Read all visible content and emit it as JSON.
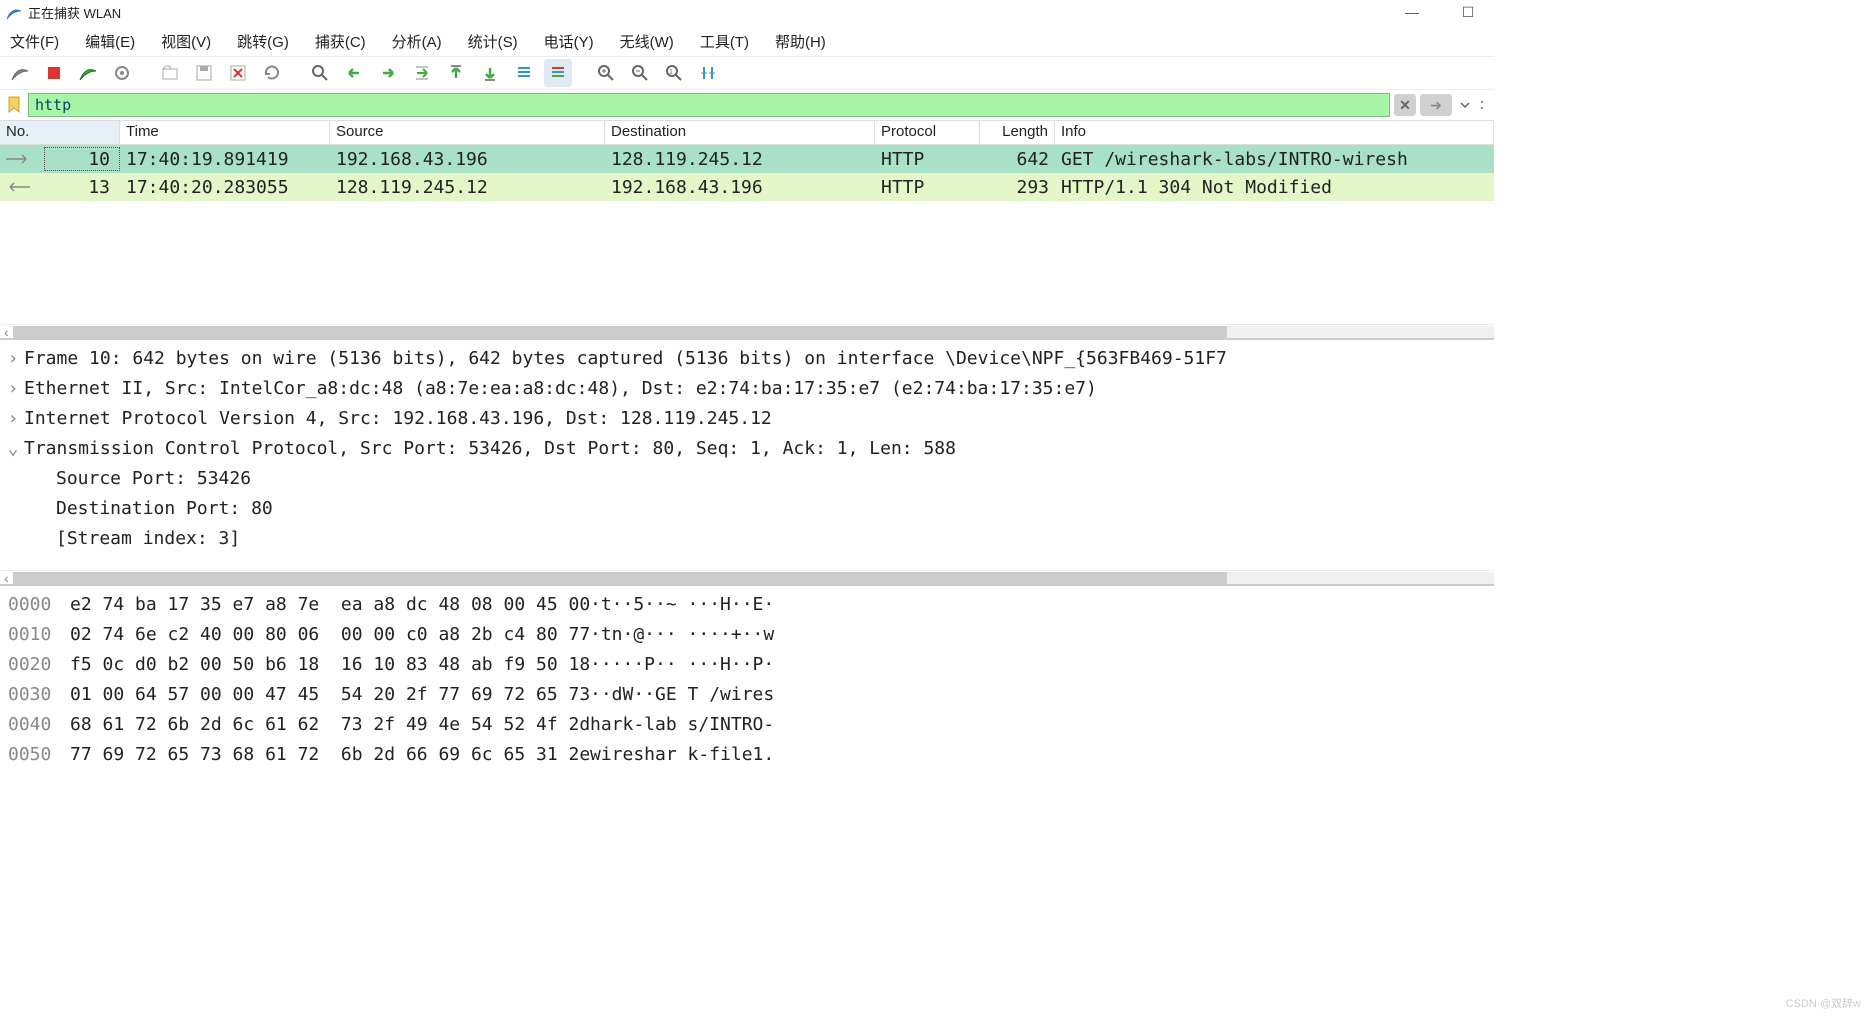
{
  "window": {
    "title": "正在捕获 WLAN",
    "minimize": "—",
    "maximize": "☐",
    "close": "✕"
  },
  "menu": {
    "file": "文件(F)",
    "edit": "编辑(E)",
    "view": "视图(V)",
    "go": "跳转(G)",
    "capture": "捕获(C)",
    "analyze": "分析(A)",
    "statistics": "统计(S)",
    "telephony": "电话(Y)",
    "wireless": "无线(W)",
    "tools": "工具(T)",
    "help": "帮助(H)"
  },
  "toolbar_icons": {
    "start": "start-icon",
    "stop": "stop-icon",
    "restart": "restart-icon",
    "options": "options-icon",
    "open": "open-icon",
    "save": "save-icon",
    "close": "close-file-icon",
    "reload": "reload-icon",
    "find": "find-icon",
    "back": "back-icon",
    "forward": "forward-icon",
    "jump": "jump-icon",
    "first": "first-icon",
    "last": "last-icon",
    "auto_scroll": "auto-scroll-icon",
    "colorize": "colorize-icon",
    "zoom_in": "zoom-in-icon",
    "zoom_out": "zoom-out-icon",
    "zoom_reset": "zoom-reset-icon",
    "resize_cols": "resize-cols-icon"
  },
  "filter": {
    "value": "http",
    "clear": "✕",
    "apply": "➔"
  },
  "columns": {
    "no": "No.",
    "time": "Time",
    "source": "Source",
    "destination": "Destination",
    "protocol": "Protocol",
    "length": "Length",
    "info": "Info"
  },
  "packets": [
    {
      "no": "10",
      "time": "17:40:19.891419",
      "source": "192.168.43.196",
      "destination": "128.119.245.12",
      "protocol": "HTTP",
      "length": "642",
      "info": "GET  /wireshark-labs/INTRO-wiresh",
      "selected": true,
      "direction": "out"
    },
    {
      "no": "13",
      "time": "17:40:20.283055",
      "source": "128.119.245.12",
      "destination": "192.168.43.196",
      "protocol": "HTTP",
      "length": "293",
      "info": "HTTP/1.1 304 Not Modified",
      "selected": false,
      "direction": "in"
    }
  ],
  "details": {
    "frame": "Frame 10: 642 bytes on wire (5136 bits), 642 bytes captured (5136 bits) on interface \\Device\\NPF_{563FB469-51F7",
    "eth": "Ethernet II, Src: IntelCor_a8:dc:48 (a8:7e:ea:a8:dc:48), Dst: e2:74:ba:17:35:e7 (e2:74:ba:17:35:e7)",
    "ip": "Internet Protocol Version 4, Src: 192.168.43.196, Dst: 128.119.245.12",
    "tcp": "Transmission Control Protocol, Src Port: 53426, Dst Port: 80, Seq: 1, Ack: 1, Len: 588",
    "tcp_src": "Source Port: 53426",
    "tcp_dst": "Destination Port: 80",
    "tcp_stream": "[Stream index: 3]"
  },
  "bytes": [
    {
      "off": "0000",
      "hex": "e2 74 ba 17 35 e7 a8 7e  ea a8 dc 48 08 00 45 00",
      "ascii": "·t··5··~ ···H··E·"
    },
    {
      "off": "0010",
      "hex": "02 74 6e c2 40 00 80 06  00 00 c0 a8 2b c4 80 77",
      "ascii": "·tn·@··· ····+··w"
    },
    {
      "off": "0020",
      "hex": "f5 0c d0 b2 00 50 b6 18  16 10 83 48 ab f9 50 18",
      "ascii": "·····P·· ···H··P·"
    },
    {
      "off": "0030",
      "hex": "01 00 64 57 00 00 47 45  54 20 2f 77 69 72 65 73",
      "ascii": "··dW··GE T /wires"
    },
    {
      "off": "0040",
      "hex": "68 61 72 6b 2d 6c 61 62  73 2f 49 4e 54 52 4f 2d",
      "ascii": "hark-lab s/INTRO-"
    },
    {
      "off": "0050",
      "hex": "77 69 72 65 73 68 61 72  6b 2d 66 69 6c 65 31 2e",
      "ascii": "wireshar k-file1."
    }
  ],
  "watermark": "CSDN @双辞w"
}
